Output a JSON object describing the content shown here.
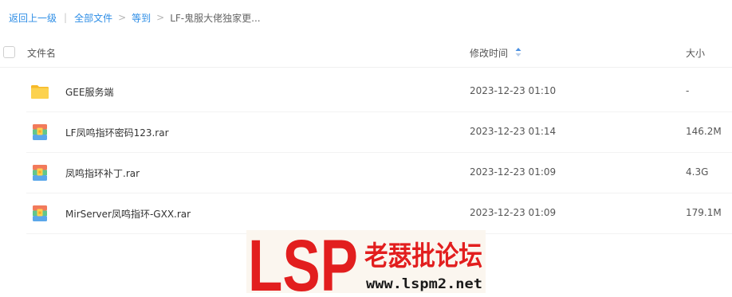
{
  "breadcrumb": {
    "back_label": "返回上一级",
    "separator": "|",
    "all_files_label": "全部文件",
    "chevron": ">",
    "folder_label": "等到",
    "current_label": "LF-鬼服大佬独家更..."
  },
  "table": {
    "columns": {
      "name": "文件名",
      "modified": "修改时间",
      "size": "大小"
    },
    "rows": [
      {
        "name": "GEE服务端",
        "modified": "2023-12-23 01:10",
        "size": "-",
        "icon": "folder-icon"
      },
      {
        "name": "LF凤鸣指环密码123.rar",
        "modified": "2023-12-23 01:14",
        "size": "146.2M",
        "icon": "rar-archive-icon"
      },
      {
        "name": "凤鸣指环补丁.rar",
        "modified": "2023-12-23 01:09",
        "size": "4.3G",
        "icon": "rar-archive-icon"
      },
      {
        "name": "MirServer凤鸣指环-GXX.rar",
        "modified": "2023-12-23 01:09",
        "size": "179.1M",
        "icon": "rar-archive-icon"
      }
    ]
  },
  "watermark": {
    "logo_text": "LSP",
    "cn_text": "老瑟批论坛",
    "url_text": "www.lspm2.net"
  },
  "colors": {
    "link": "#2e8ee6",
    "folder": "#f9c940",
    "watermark_red": "#e21e1e",
    "sort_active": "#4a90e2"
  }
}
